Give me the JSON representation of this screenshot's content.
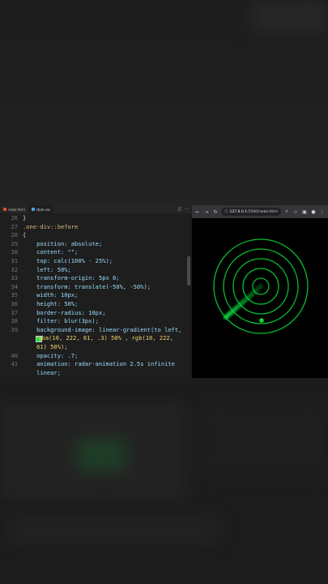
{
  "editor": {
    "tabs": [
      {
        "label": "radar.html",
        "color": "#e44d26",
        "active": false
      },
      {
        "label": "style.css",
        "color": "#42a5f5",
        "active": true
      }
    ],
    "lines": [
      {
        "n": "26",
        "text": "}"
      },
      {
        "n": "27",
        "text": ".one-div::before"
      },
      {
        "n": "28",
        "text": "{"
      },
      {
        "n": "29",
        "text": "    position: absolute;"
      },
      {
        "n": "30",
        "text": "    content: \"\";"
      },
      {
        "n": "31",
        "text": "    top: calc(100% - 25%);"
      },
      {
        "n": "32",
        "text": "    left: 50%;"
      },
      {
        "n": "33",
        "text": "    transform-origin: 5px 0;"
      },
      {
        "n": "34",
        "text": "    transform: translate(-50%, -50%);"
      },
      {
        "n": "35",
        "text": "    width: 10px;"
      },
      {
        "n": "36",
        "text": "    height: 50%;"
      },
      {
        "n": "37",
        "text": "    border-radius: 10px;"
      },
      {
        "n": "38",
        "text": "    filter: blur(3px);"
      },
      {
        "n": "39",
        "text": "    background-image: linear-gradient(to left,"
      },
      {
        "n": "",
        "text": "    rgba(10, 222, 61, .3) 50% , rgb(10, 222,"
      },
      {
        "n": "",
        "text": "    61) 50%);"
      },
      {
        "n": "40",
        "text": "    opacity: .7;"
      },
      {
        "n": "41",
        "text": "    animation: radar-animation 2.5s infinite"
      },
      {
        "n": "",
        "text": "    linear;"
      }
    ]
  },
  "browser": {
    "url_host": "127.0.0.1",
    "url_rest": ":5500/radar.html",
    "radar_color": "#0ade3d"
  }
}
